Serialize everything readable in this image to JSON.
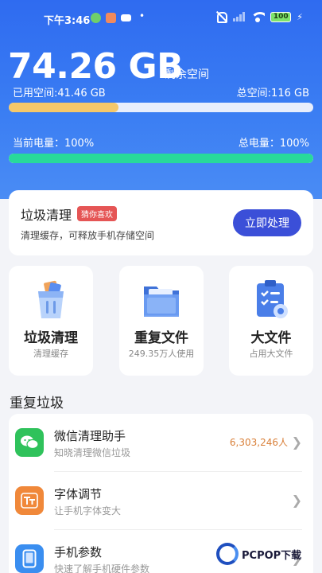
{
  "status_bar": {
    "time": "下午3:46",
    "battery": "100"
  },
  "storage": {
    "remaining_value": "74.26 GB",
    "remaining_label": "剩余空间",
    "used_label": "已用空间:41.46 GB",
    "total_label": "总空间:116 GB",
    "used_fraction": 0.36
  },
  "power": {
    "current_label": "当前电量：100%",
    "total_label": "总电量：100%",
    "level_fraction": 1.0
  },
  "promo": {
    "title": "垃圾清理",
    "tag": "猜你喜欢",
    "description": "清理缓存，可释放手机存储空间",
    "button_label": "立即处理"
  },
  "tiles": [
    {
      "name": "垃圾清理",
      "desc": "清理缓存",
      "icon": "trash-bin-icon"
    },
    {
      "name": "重复文件",
      "desc": "249.35万人使用",
      "icon": "folder-icon"
    },
    {
      "name": "大文件",
      "desc": "占用大文件",
      "icon": "clipboard-icon"
    }
  ],
  "section": {
    "title": "重复垃圾"
  },
  "list": [
    {
      "title": "微信清理助手",
      "desc": "知晓清理微信垃圾",
      "count": "6,303,246人",
      "icon": "wechat-icon",
      "color": "#2fc25b"
    },
    {
      "title": "字体调节",
      "desc": "让手机字体变大",
      "count": "",
      "icon": "font-icon",
      "color": "#f0883a"
    },
    {
      "title": "手机参数",
      "desc": "快速了解手机硬件参数",
      "count": "",
      "icon": "phone-icon",
      "color": "#3a8ef0"
    }
  ],
  "watermark": {
    "text": "PCPOP下载"
  },
  "colors": {
    "hero_blue": "#2f6bf0",
    "action_button": "#3b4fd8",
    "storage_fill": "#f5c86a",
    "power_fill": "#28d99a",
    "tag_red": "#e55555",
    "count_orange": "#d9803a"
  }
}
